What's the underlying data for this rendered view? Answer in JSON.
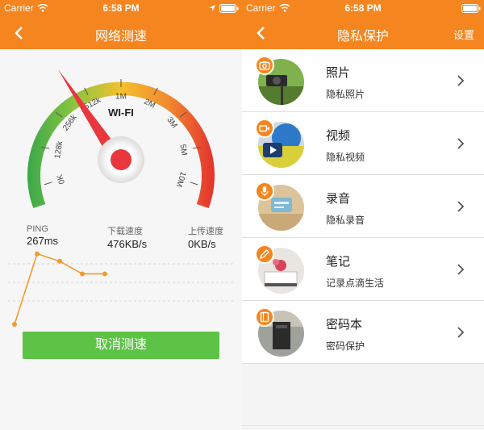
{
  "colors": {
    "accent": "#f5851f",
    "button_green": "#5cc346",
    "needle_red": "#e8373d",
    "line_orange": "#f29a2e"
  },
  "status_bar": {
    "carrier": "Carrier",
    "time": "6:58 PM"
  },
  "speed_test": {
    "title": "网络测速",
    "network_type": "WI-FI",
    "gauge_ticks": [
      "0K",
      "128k",
      "256k",
      "512k",
      "1M",
      "2M",
      "3M",
      "5M",
      "10M"
    ],
    "stats": [
      {
        "label": "PING",
        "value": "267ms"
      },
      {
        "label": "下载速度",
        "value": "476KB/s"
      },
      {
        "label": "上传速度",
        "value": "0KB/s"
      }
    ],
    "cancel_label": "取消测速",
    "icons": [
      "chevron-left-icon",
      "wifi-icon",
      "location-arrow-icon",
      "battery-icon"
    ]
  },
  "privacy": {
    "title": "隐私保护",
    "settings_label": "设置",
    "items": [
      {
        "title": "照片",
        "subtitle": "隐私照片",
        "icon": "camera-icon"
      },
      {
        "title": "视频",
        "subtitle": "隐私视频",
        "icon": "video-camera-icon"
      },
      {
        "title": "录音",
        "subtitle": "隐私录音",
        "icon": "microphone-icon"
      },
      {
        "title": "笔记",
        "subtitle": "记录点滴生活",
        "icon": "pencil-icon"
      },
      {
        "title": "密码本",
        "subtitle": "密码保护",
        "icon": "notebook-icon"
      }
    ]
  },
  "chart_data": {
    "type": "line",
    "x": [
      1,
      2,
      3,
      4,
      5
    ],
    "y": [
      0,
      0.95,
      0.85,
      0.68,
      0.68
    ],
    "ylim": [
      0,
      1
    ],
    "grid": true
  }
}
